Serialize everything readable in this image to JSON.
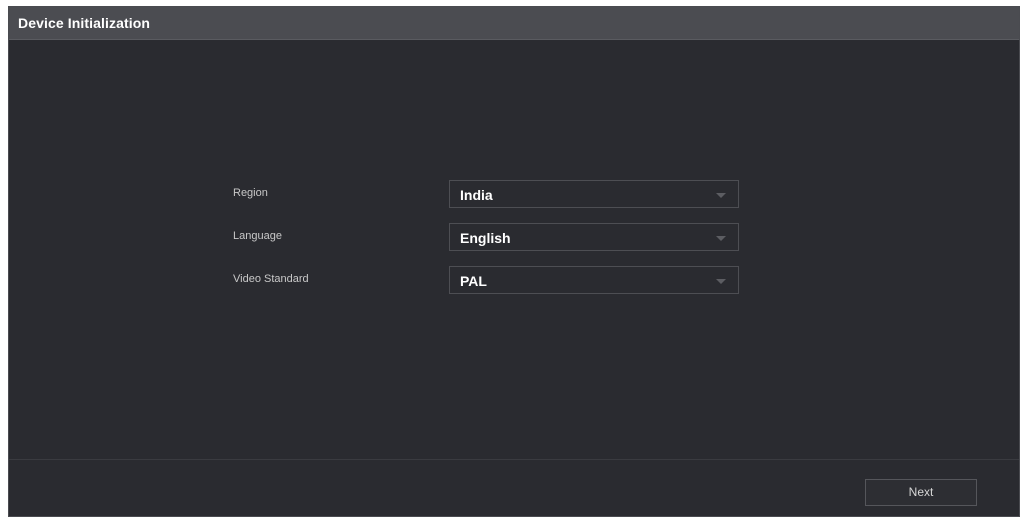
{
  "window": {
    "title": "Device Initialization"
  },
  "form": {
    "fields": [
      {
        "label": "Region",
        "value": "India"
      },
      {
        "label": "Language",
        "value": "English"
      },
      {
        "label": "Video Standard",
        "value": "PAL"
      }
    ]
  },
  "footer": {
    "next_label": "Next"
  },
  "icons": {
    "dropdown": "chevron-down-icon"
  },
  "colors": {
    "background": "#2a2b30",
    "titlebar": "#4b4c51",
    "field_border": "#4d4e53",
    "text": "#ffffff",
    "label_text": "#c8c8c8"
  }
}
